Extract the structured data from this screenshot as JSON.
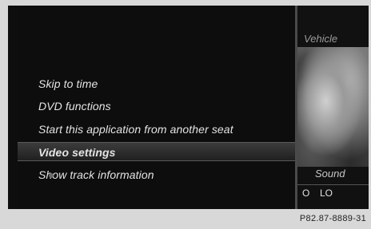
{
  "menu": {
    "items": [
      {
        "label": "Skip to time"
      },
      {
        "label": "DVD functions"
      },
      {
        "label": "Start this application from another seat"
      },
      {
        "label": "Video settings",
        "selected": true
      },
      {
        "label": "Show track information",
        "checkbox_icon": "bullet-icon"
      }
    ]
  },
  "right_panel": {
    "vehicle_label": "Vehicle",
    "sound_label": "Sound",
    "o_label": "O",
    "lo_label": "LO"
  },
  "figure_code": "P82.87-8889-31",
  "colors": {
    "background": "#0b0b0b",
    "highlight": "#3c3c3c",
    "text": "#e4e4e4"
  }
}
